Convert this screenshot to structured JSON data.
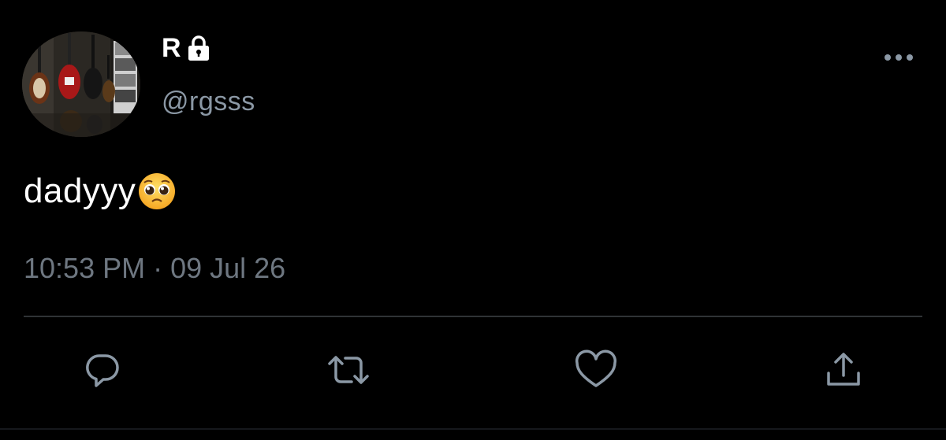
{
  "tweet": {
    "author": {
      "display_name": "R",
      "handle": "@rgsss",
      "protected": true,
      "avatar": "avatar-guitars-image"
    },
    "text": "dadyyy",
    "emoji": "pleading-face-emoji",
    "timestamp": {
      "time": "10:53 PM",
      "separator": "·",
      "date": "09 Jul 26"
    }
  },
  "actions": [
    {
      "name": "reply",
      "icon": "reply-icon"
    },
    {
      "name": "retweet",
      "icon": "retweet-icon"
    },
    {
      "name": "like",
      "icon": "heart-icon"
    },
    {
      "name": "share",
      "icon": "share-icon"
    }
  ],
  "colors": {
    "background": "#000000",
    "primary_text": "#ffffff",
    "secondary_text": "#8b98a5",
    "timestamp_text": "#6e7781",
    "icon": "#8b98a5",
    "divider": "#2f3336"
  }
}
